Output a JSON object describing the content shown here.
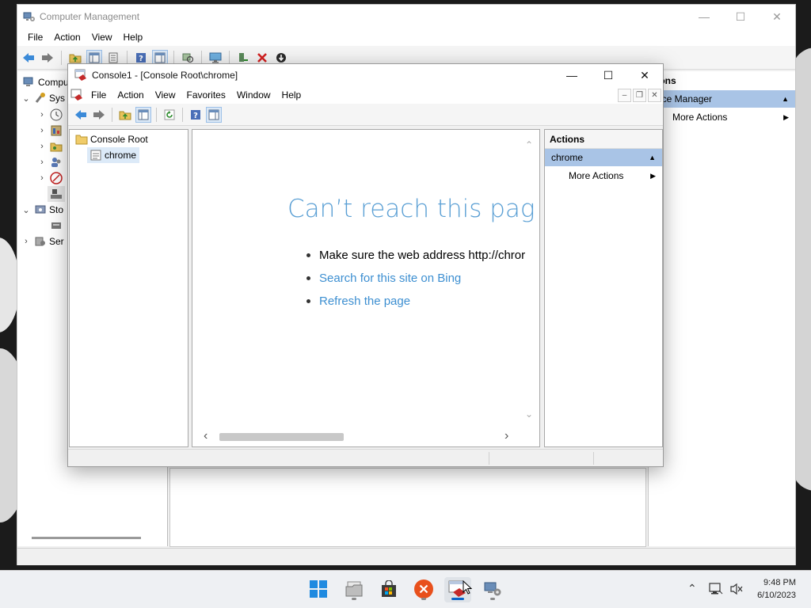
{
  "desktop": {
    "bg": "#1b1b1b"
  },
  "cm": {
    "title": "Computer Management",
    "menu": [
      "File",
      "Action",
      "View",
      "Help"
    ],
    "tree": {
      "root_partial": "Compu",
      "system_partial": "Sys",
      "storage_partial": "Sto",
      "services_partial": "Ser"
    },
    "actions": {
      "header_partial": "tions",
      "selected_partial": "vice Manager",
      "more": "More Actions"
    }
  },
  "c1": {
    "title": "Console1 - [Console Root\\chrome]",
    "menu": [
      "File",
      "Action",
      "View",
      "Favorites",
      "Window",
      "Help"
    ],
    "tree": {
      "root": "Console Root",
      "child": "chrome"
    },
    "content": {
      "heading": "Can’t reach this pag",
      "bullets": [
        {
          "text": "Make sure the web address http://chror",
          "link": false
        },
        {
          "text": "Search for this site on Bing",
          "link": true
        },
        {
          "text": "Refresh the page",
          "link": true
        }
      ]
    },
    "actions": {
      "header": "Actions",
      "selected": "chrome",
      "more": "More Actions"
    }
  },
  "taskbar": {
    "time": "9:48 PM",
    "date": "6/10/2023",
    "apps": [
      "start-icon",
      "file-explorer-icon",
      "store-icon",
      "x-app-icon",
      "console-icon",
      "computer-management-icon"
    ],
    "colors": {
      "accent": "#0a64c8",
      "start": "#1f8ae0",
      "x_app": "#e8501c",
      "link": "#3d8fd1"
    }
  }
}
